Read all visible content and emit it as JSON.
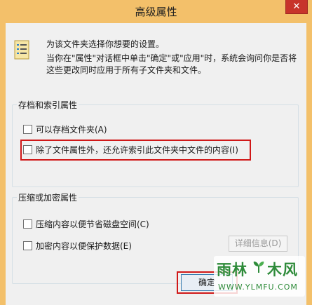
{
  "window": {
    "title": "高级属性",
    "close_glyph": "✕"
  },
  "header": {
    "icon": "folder-properties-icon",
    "line1": "为该文件夹选择你想要的设置。",
    "line2": "当你在\"属性\"对话框中单击\"确定\"或\"应用\"时，系统会询问你是否将这些更改同时应用于所有子文件夹和文件。"
  },
  "archive_group": {
    "label": "存档和索引属性",
    "items": [
      {
        "label": "可以存档文件夹(A)",
        "checked": false
      },
      {
        "label": "除了文件属性外，还允许索引此文件夹中文件的内容(I)",
        "checked": false
      }
    ]
  },
  "compress_group": {
    "label": "压缩或加密属性",
    "items": [
      {
        "label": "压缩内容以便节省磁盘空间(C)",
        "checked": false
      },
      {
        "label": "加密内容以便保护数据(E)",
        "checked": false
      }
    ],
    "details_label": "详细信息(D)"
  },
  "footer": {
    "ok_label": "确定"
  },
  "watermark": {
    "text_left": "雨林",
    "text_right": "木风",
    "url": "WWW.YLMFU.COM"
  },
  "colors": {
    "title_bar": "#f3c06a",
    "highlight": "#d01818",
    "watermark": "#2e8b3a"
  }
}
